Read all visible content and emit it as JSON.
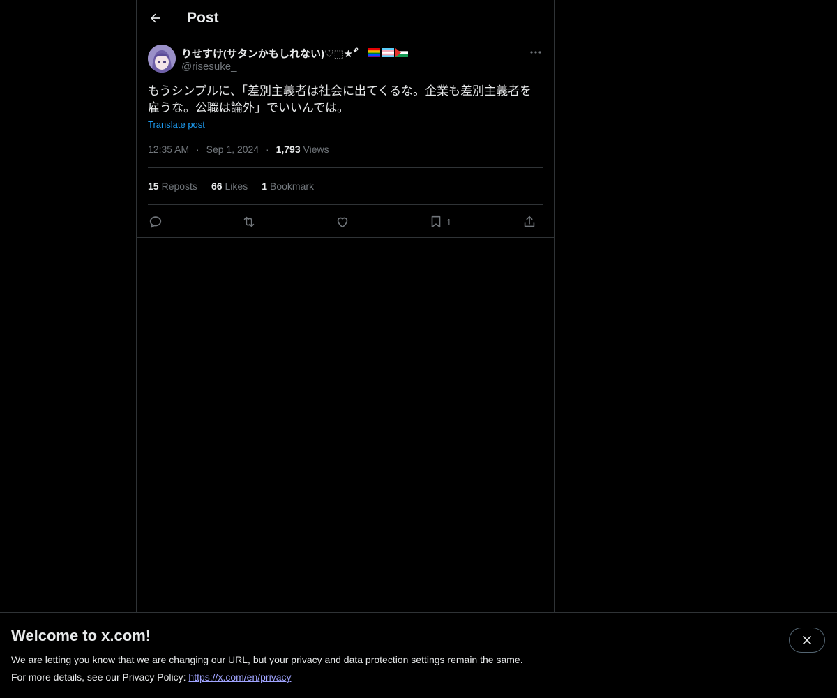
{
  "header": {
    "title": "Post"
  },
  "post": {
    "author_name": "りせすけ(サタンかもしれない)♡⬚★*゚",
    "handle": "@risesuke_",
    "text": "もうシンプルに、「差別主義者は社会に出てくるな。企業も差別主義者を\n雇うな。公職は論外」でいいんでは。",
    "translate_label": "Translate post",
    "time": "12:35 AM",
    "date": "Sep 1, 2024",
    "views_count": "1,793",
    "views_label": "Views",
    "reposts_count": "15",
    "reposts_label": "Reposts",
    "likes_count": "66",
    "likes_label": "Likes",
    "bookmarks_count": "1",
    "bookmarks_label": "Bookmark",
    "bookmark_action_count": "1",
    "separator": "·"
  },
  "icons": {
    "back": "arrow-left-icon",
    "more": "more-horizontal-icon",
    "reply": "reply-icon",
    "repost": "repost-icon",
    "like": "heart-icon",
    "bookmark": "bookmark-icon",
    "share": "share-icon",
    "close": "close-icon"
  },
  "banner": {
    "title": "Welcome to x.com!",
    "line1": "We are letting you know that we are changing our URL, but your privacy and data protection settings remain the same.",
    "line2_prefix": "For more details, see our Privacy Policy: ",
    "link": "https://x.com/en/privacy"
  },
  "colors": {
    "background": "#000000",
    "text": "#e7e9ea",
    "muted": "#71767b",
    "link": "#1d9bf0",
    "border": "#2f3336"
  }
}
